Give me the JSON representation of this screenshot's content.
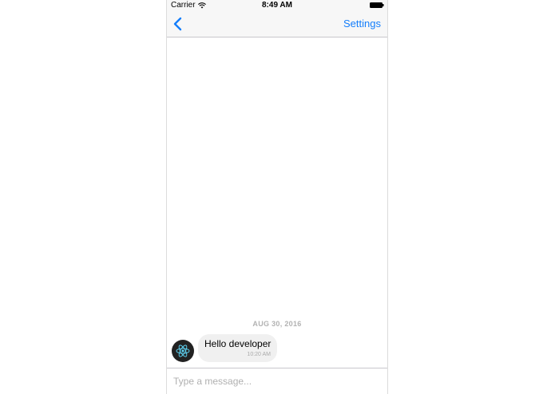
{
  "status_bar": {
    "carrier": "Carrier",
    "time": "8:49 AM"
  },
  "nav": {
    "back_icon": "chevron-left-icon",
    "settings_label": "Settings"
  },
  "chat": {
    "date_separator": "AUG 30, 2016",
    "messages": [
      {
        "text": "Hello developer",
        "time": "10:20 AM",
        "avatar_icon": "react-logo-icon"
      }
    ]
  },
  "composer": {
    "placeholder": "Type a message..."
  },
  "colors": {
    "accent": "#147efb",
    "bar_background": "#f7f7f7",
    "bubble_background": "#f0f0f0",
    "avatar_background": "#222222",
    "react_logo": "#61dafb"
  }
}
